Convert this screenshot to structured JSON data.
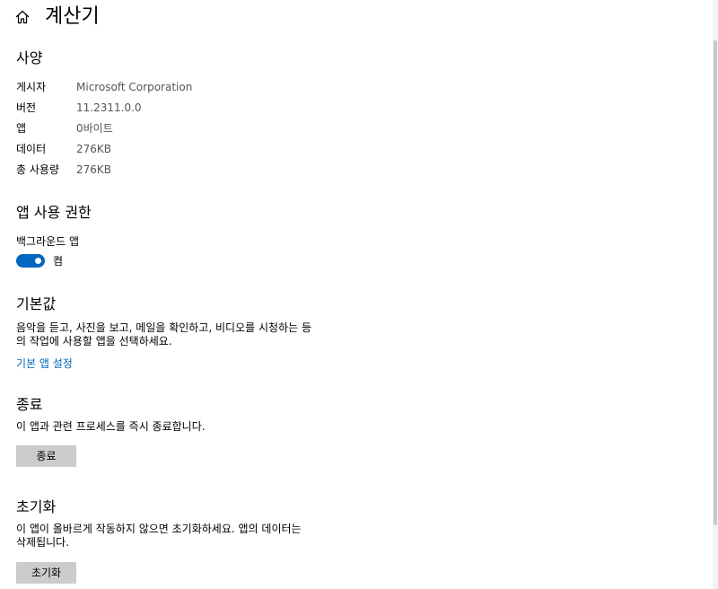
{
  "header": {
    "title": "계산기",
    "home_icon": "home-icon"
  },
  "specs": {
    "title": "사양",
    "rows": [
      {
        "label": "게시자",
        "value": "Microsoft Corporation"
      },
      {
        "label": "버전",
        "value": "11.2311.0.0"
      },
      {
        "label": "앱",
        "value": "0바이트"
      },
      {
        "label": "데이터",
        "value": "276KB"
      },
      {
        "label": "총 사용량",
        "value": "276KB"
      }
    ]
  },
  "permissions": {
    "title": "앱 사용 권한",
    "background_label": "백그라운드 앱",
    "toggle_state": "켬",
    "toggle_on": true,
    "accent_color": "#0067c0"
  },
  "defaults": {
    "title": "기본값",
    "description_line1": "음악을 듣고, 사진을 보고, 메일을 확인하고, 비디오를 시청하는 등",
    "description_line2": "의 작업에 사용할 앱을 선택하세요.",
    "link_label": "기본 앱 설정",
    "link_color": "#0066b4"
  },
  "terminate": {
    "title": "종료",
    "description": "이 앱과 관련 프로세스를 즉시 종료합니다.",
    "button_label": "종료"
  },
  "reset": {
    "title": "초기화",
    "description_line1": "이 앱이 올바르게 작동하지 않으면 초기화하세요. 앱의 데이터는",
    "description_line2": "삭제됩니다.",
    "button_label": "초기화"
  }
}
